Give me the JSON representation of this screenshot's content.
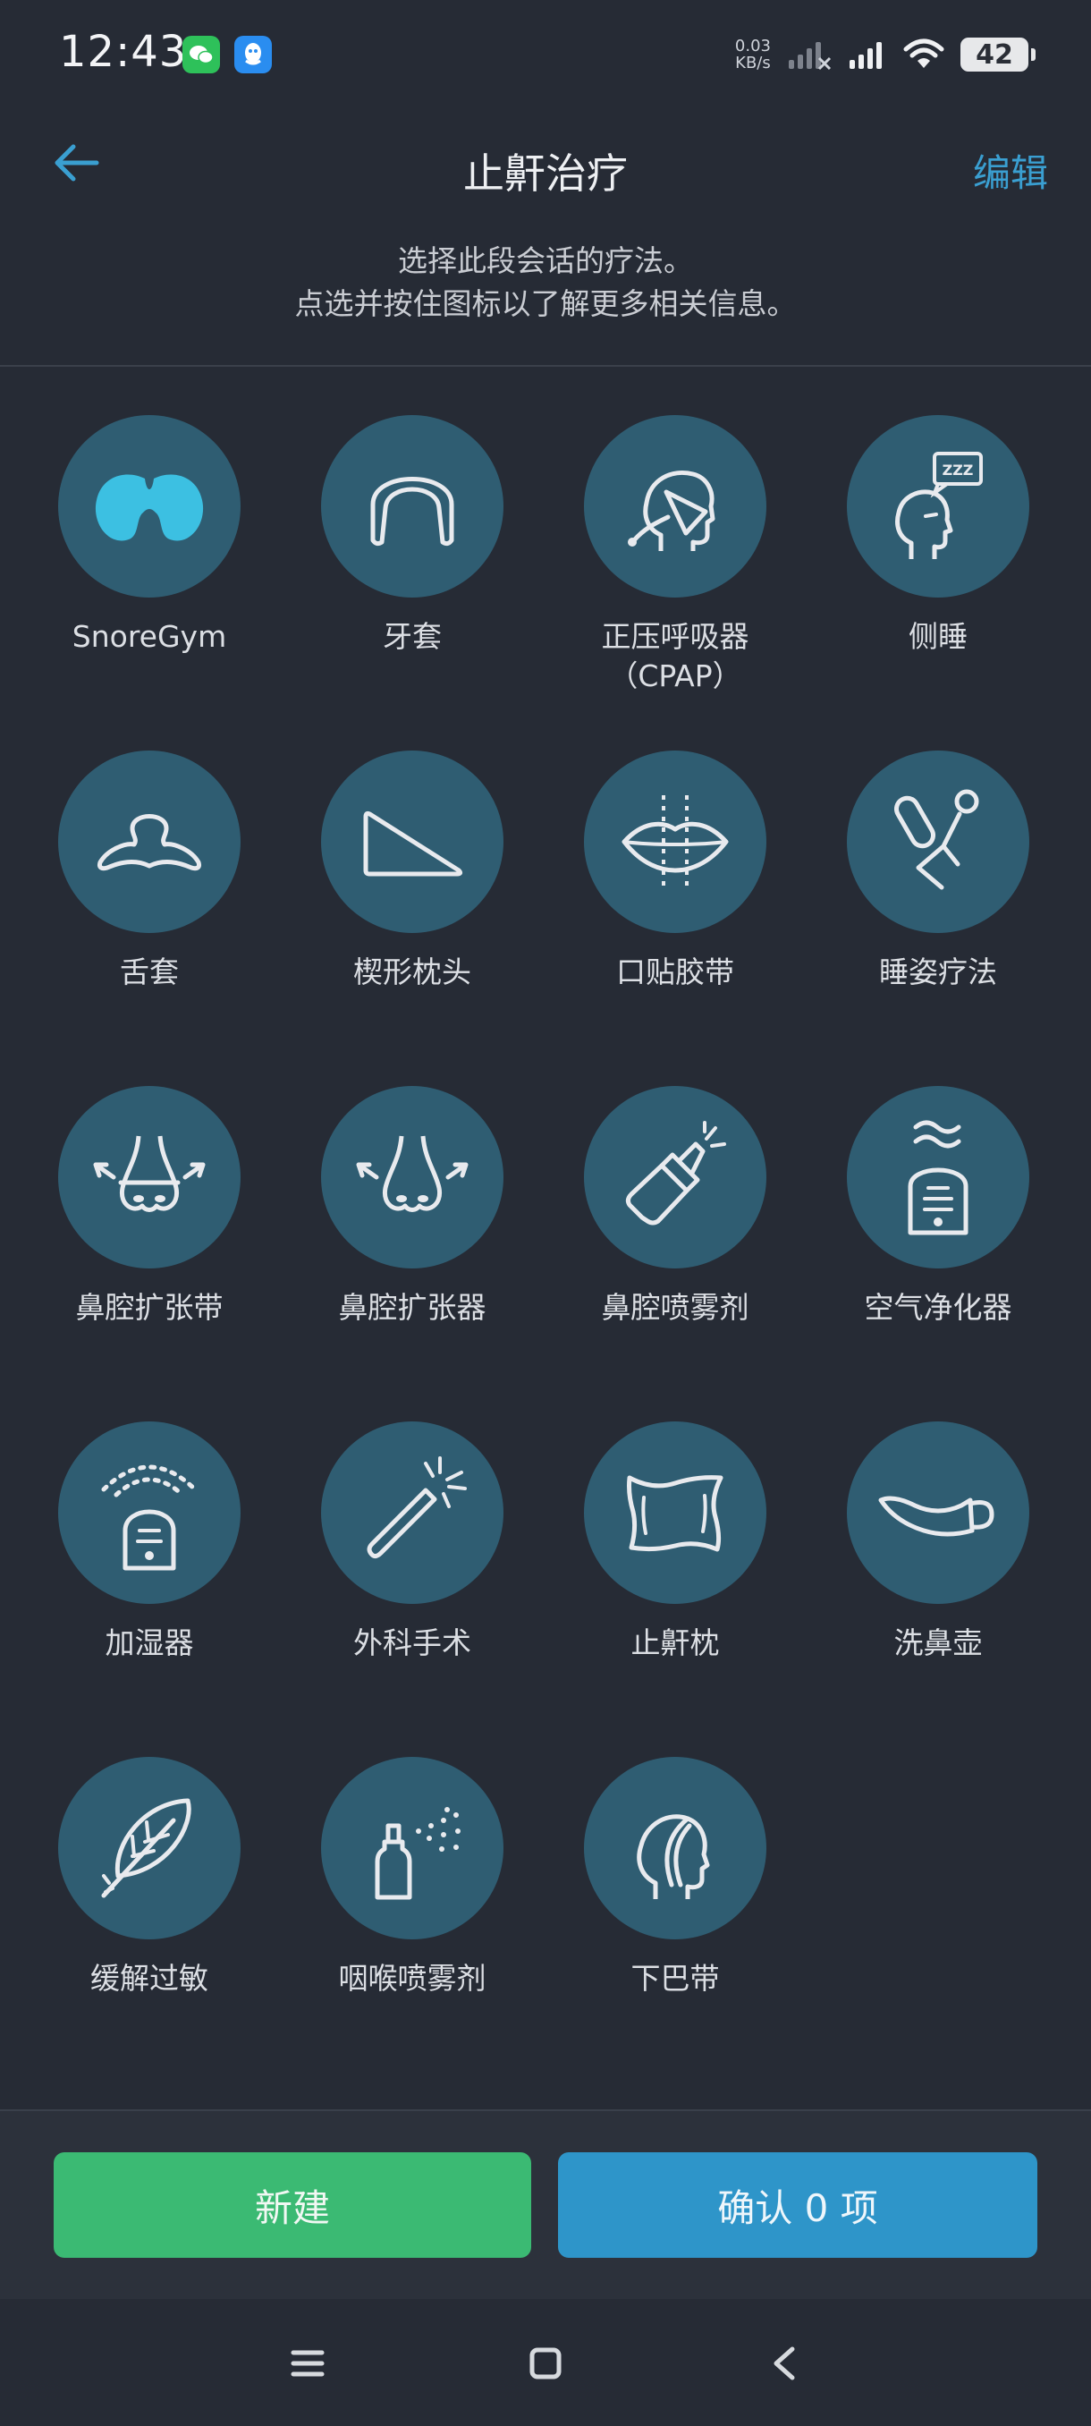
{
  "status_bar": {
    "time": "12:43",
    "net_speed_value": "0.03",
    "net_speed_unit": "KB/s",
    "battery": "42",
    "icons": [
      "wechat-icon",
      "qq-icon",
      "signal-weak-icon",
      "signal-icon",
      "wifi-icon",
      "battery-icon"
    ]
  },
  "header": {
    "title": "止鼾治疗",
    "edit_label": "编辑",
    "subtitle_line1": "选择此段会话的疗法。",
    "subtitle_line2": "点选并按住图标以了解更多相关信息。"
  },
  "therapies": [
    {
      "label": "SnoreGym",
      "icon": "snoregym-icon"
    },
    {
      "label": "牙套",
      "icon": "mouthguard-icon"
    },
    {
      "label": "正压呼吸器\n（CPAP）",
      "icon": "cpap-icon"
    },
    {
      "label": "侧睡",
      "icon": "side-sleep-icon"
    },
    {
      "label": "舌套",
      "icon": "tongue-device-icon"
    },
    {
      "label": "楔形枕头",
      "icon": "wedge-pillow-icon"
    },
    {
      "label": "口贴胶带",
      "icon": "mouth-tape-icon"
    },
    {
      "label": "睡姿疗法",
      "icon": "positional-therapy-icon"
    },
    {
      "label": "鼻腔扩张带",
      "icon": "nasal-strip-icon"
    },
    {
      "label": "鼻腔扩张器",
      "icon": "nasal-dilator-icon"
    },
    {
      "label": "鼻腔喷雾剂",
      "icon": "nasal-spray-icon"
    },
    {
      "label": "空气净化器",
      "icon": "air-purifier-icon"
    },
    {
      "label": "加湿器",
      "icon": "humidifier-icon"
    },
    {
      "label": "外科手术",
      "icon": "surgery-icon"
    },
    {
      "label": "止鼾枕",
      "icon": "anti-snore-pillow-icon"
    },
    {
      "label": "洗鼻壶",
      "icon": "neti-pot-icon"
    },
    {
      "label": "缓解过敏",
      "icon": "allergy-relief-icon"
    },
    {
      "label": "咽喉喷雾剂",
      "icon": "throat-spray-icon"
    },
    {
      "label": "下巴带",
      "icon": "chin-strap-icon"
    }
  ],
  "buttons": {
    "new_label": "新建",
    "confirm_label": "确认 0 项"
  },
  "colors": {
    "background": "#262b35",
    "accent_blue": "#2e95c9",
    "accent_green": "#3bba73",
    "circle": "#2f5d72"
  }
}
